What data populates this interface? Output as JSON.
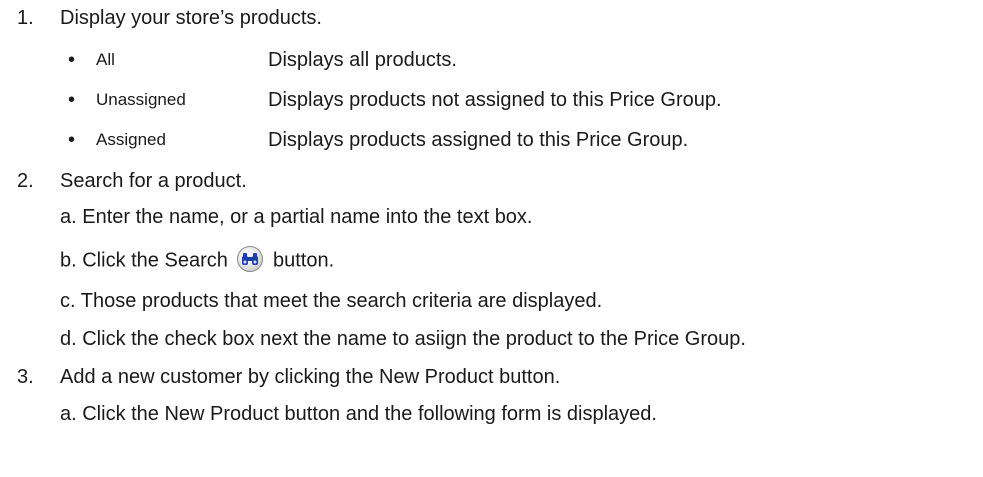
{
  "steps": [
    {
      "number": "1.",
      "text": "Display your store’s products.",
      "options": [
        {
          "bullet": "•",
          "name": "All",
          "description": "Displays all products."
        },
        {
          "bullet": "•",
          "name": "Unassigned",
          "description": "Displays products not assigned to this Price Group."
        },
        {
          "bullet": "•",
          "name": "Assigned",
          "description": "Displays products assigned to this Price Group."
        }
      ]
    },
    {
      "number": "2.",
      "text": "Search for a product.",
      "substeps": [
        "a. Enter the name, or a partial name into the text box.",
        {
          "before": "b. Click the Search",
          "icon": "binoculars-search-icon",
          "after": "button."
        },
        "c. Those products that meet the search criteria are displayed.",
        "d. Click the check box next the name to asiign the product to the Price Group."
      ]
    },
    {
      "number": "3.",
      "text": "Add a new customer by clicking the New Product button.",
      "substeps": [
        "a. Click the New Product button and the following form is displayed."
      ]
    }
  ],
  "colors": {
    "text": "#1a1a1a",
    "icon_blue": "#1f3fa8"
  }
}
